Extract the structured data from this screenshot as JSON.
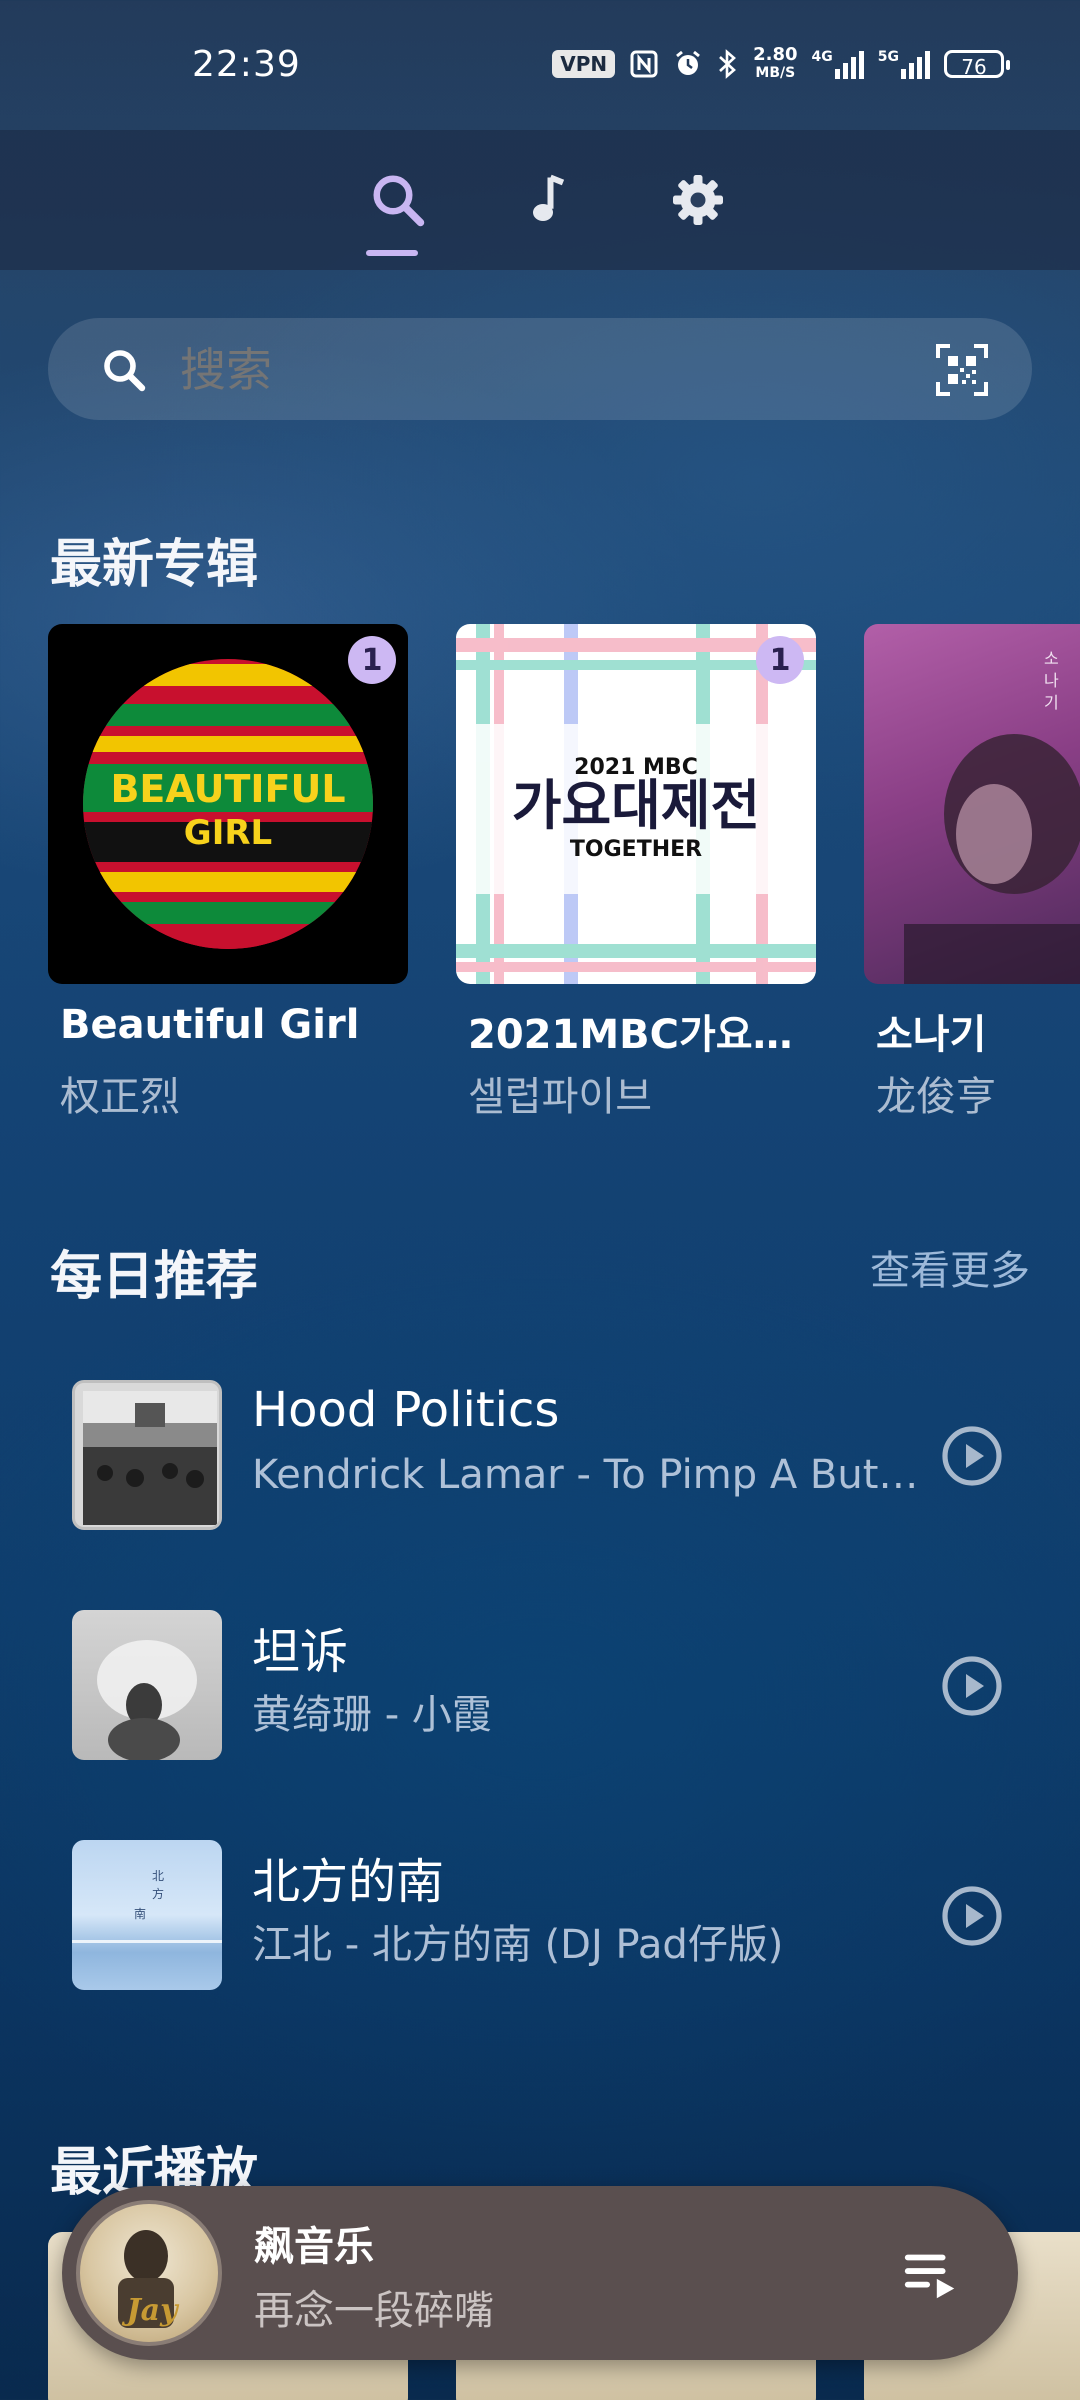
{
  "status_bar": {
    "time": "22:39",
    "vpn": "VPN",
    "net_speed_value": "2.80",
    "net_speed_unit": "MB/S",
    "net1": "4G",
    "net2": "5G",
    "battery": "76"
  },
  "tabs": [
    {
      "name": "search",
      "icon": "search-icon",
      "active": true
    },
    {
      "name": "music",
      "icon": "music-note-icon",
      "active": false
    },
    {
      "name": "settings",
      "icon": "gear-icon",
      "active": false
    }
  ],
  "search": {
    "placeholder": "搜索"
  },
  "new_albums": {
    "title": "最新专辑",
    "items": [
      {
        "title": "Beautiful Girl",
        "artist": "权正烈",
        "badge": "1"
      },
      {
        "title": "2021MBC가요대제전",
        "artist": "셀럽파이브",
        "badge": "1"
      },
      {
        "title": "소나기",
        "artist": "龙俊亨",
        "badge": ""
      }
    ]
  },
  "daily": {
    "title": "每日推荐",
    "more": "查看更多",
    "items": [
      {
        "title": "Hood Politics",
        "subtitle": "Kendrick Lamar - To Pimp A Butterfly"
      },
      {
        "title": "坦诉",
        "subtitle": "黄绮珊 - 小霞"
      },
      {
        "title": "北方的南",
        "subtitle": "江北 - 北方的南 (DJ Pad仔版)"
      }
    ]
  },
  "recent": {
    "title": "最近播放"
  },
  "now_playing": {
    "title": "飙音乐",
    "subtitle": "再念一段碎嘴"
  },
  "colors": {
    "accent": "#cdb8f3",
    "player_bg": "#5a4f4f"
  }
}
